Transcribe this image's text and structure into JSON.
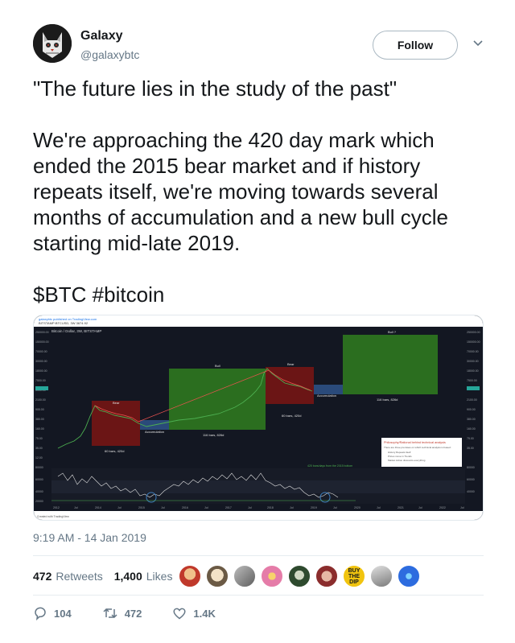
{
  "author": {
    "name": "Galaxy",
    "handle": "@galaxybtc",
    "avatar_icon": "cat-avatar-icon"
  },
  "follow_label": "Follow",
  "tweet": {
    "line1": "\"The future lies in the study of the past\"",
    "line2": "We're approaching the 420 day mark which ended the 2015 bear market and if history repeats itself, we're moving towards several months of accumulation and a new bull cycle starting mid-late 2019.",
    "line3": "$BTC #bitcoin"
  },
  "media": {
    "description_icon": "bitcoin-chart-image",
    "chart_title": "Bitcoin / Dollar, 3W, BITSTAMP",
    "labels": {
      "bear1": "Bear",
      "bull1": "Bull",
      "bear2": "Bear",
      "bull2": "Bull ?",
      "acc1": "Accumulation",
      "acc2": "Accumulation",
      "box1": "60 bars, 420d",
      "box2": "116 bars, 826d",
      "box3": "60 bars, 420d",
      "box4": "116 bars, 826d",
      "legend_title": "Philosophy/Rational behind technical analysis",
      "legend_note": "There are three premises on which technical analysis is based:",
      "legend_items": [
        "History Repeats itself",
        "Prices move in Trends",
        "Market Action discounts everything"
      ],
      "green_note": "420 bars/days from the 2015 bottom",
      "footer": "Created with TradingView",
      "x_ticks": [
        "2012",
        "Jul",
        "2014",
        "Jul",
        "2015",
        "Jul",
        "2016",
        "Jul",
        "2017",
        "Jul",
        "2018",
        "Jul",
        "2019",
        "Jul",
        "2020",
        "Jul",
        "2021",
        "Jul",
        "2022",
        "Jul"
      ]
    }
  },
  "timestamp": "9:19 AM - 14 Jan 2019",
  "stats": {
    "retweets_count": "472",
    "retweets_label": "Retweets",
    "likes_count": "1,400",
    "likes_label": "Likes"
  },
  "likers": [
    {
      "icon": "liker-avatar-1",
      "color": "#c0392b"
    },
    {
      "icon": "liker-avatar-2",
      "color": "#d9c8a8"
    },
    {
      "icon": "liker-avatar-3",
      "color": "#9e9e9e"
    },
    {
      "icon": "liker-avatar-4",
      "color": "#e57ca8"
    },
    {
      "icon": "liker-avatar-5",
      "color": "#2e4a2e"
    },
    {
      "icon": "liker-avatar-6",
      "color": "#8b2d2d"
    },
    {
      "icon": "liker-avatar-7",
      "color": "#f1c40f"
    },
    {
      "icon": "liker-avatar-8",
      "color": "#7a7a7a"
    },
    {
      "icon": "liker-avatar-9",
      "color": "#2d6cdf"
    }
  ],
  "actions": {
    "reply_count": "104",
    "retweet_count": "472",
    "like_count": "1.4K"
  },
  "colors": {
    "accent": "#1da1f2",
    "muted": "#657786",
    "chart_bg": "#131722",
    "bull_green": "#2b6e1f",
    "bear_red": "#6b1515",
    "acc_blue": "#2a4a7a"
  }
}
